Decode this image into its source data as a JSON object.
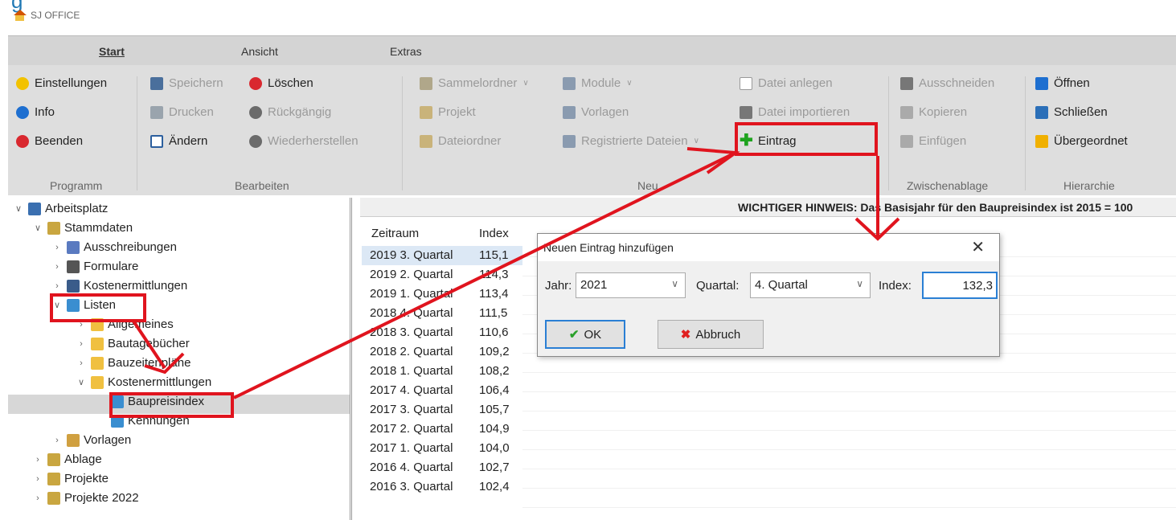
{
  "titlebar": {
    "app_name": "SJ OFFICE"
  },
  "tabs": [
    "Start",
    "Ansicht",
    "Extras"
  ],
  "ribbon": {
    "programm": {
      "label": "Programm",
      "items": [
        "Einstellungen",
        "Info",
        "Beenden"
      ]
    },
    "bearbeiten": {
      "label": "Bearbeiten",
      "items": [
        "Speichern",
        "Löschen",
        "Drucken",
        "Rückgängig",
        "Ändern",
        "Wiederherstellen"
      ]
    },
    "neu": {
      "label": "Neu",
      "items": [
        "Sammelordner",
        "Module",
        "Projekt",
        "Vorlagen",
        "Dateiordner",
        "Registrierte Dateien",
        "Datei anlegen",
        "Datei importieren",
        "Eintrag"
      ]
    },
    "zwischenablage": {
      "label": "Zwischenablage",
      "items": [
        "Ausschneiden",
        "Kopieren",
        "Einfügen"
      ]
    },
    "hierarchie": {
      "label": "Hierarchie",
      "items": [
        "Öffnen",
        "Schließen",
        "Übergeordnet"
      ]
    }
  },
  "tree": {
    "nodes": [
      "Arbeitsplatz",
      "Stammdaten",
      "Ausschreibungen",
      "Formulare",
      "Kostenermittlungen",
      "Listen",
      "Allgemeines",
      "Bautagebücher",
      "Bauzeitenpläne",
      "Kostenermittlungen",
      "Baupreisindex",
      "Kennungen",
      "Vorlagen",
      "Ablage",
      "Projekte",
      "Projekte 2022"
    ]
  },
  "notice": "WICHTIGER HINWEIS: Das Basisjahr für den Baupreisindex ist 2015 = 100",
  "table": {
    "headers": [
      "Zeitraum",
      "Index"
    ],
    "rows": [
      [
        "2019 3. Quartal",
        "115,1"
      ],
      [
        "2019 2. Quartal",
        "114,3"
      ],
      [
        "2019 1. Quartal",
        "113,4"
      ],
      [
        "2018 4. Quartal",
        "111,5"
      ],
      [
        "2018 3. Quartal",
        "110,6"
      ],
      [
        "2018 2. Quartal",
        "109,2"
      ],
      [
        "2018 1. Quartal",
        "108,2"
      ],
      [
        "2017 4. Quartal",
        "106,4"
      ],
      [
        "2017 3. Quartal",
        "105,7"
      ],
      [
        "2017 2. Quartal",
        "104,9"
      ],
      [
        "2017 1. Quartal",
        "104,0"
      ],
      [
        "2016 4. Quartal",
        "102,7"
      ],
      [
        "2016 3. Quartal",
        "102,4"
      ]
    ]
  },
  "dialog": {
    "title": "Neuen Eintrag hinzufügen",
    "jahr_label": "Jahr:",
    "jahr_value": "2021",
    "quartal_label": "Quartal:",
    "quartal_value": "4. Quartal",
    "index_label": "Index:",
    "index_value": "132,3",
    "ok_label": "OK",
    "cancel_label": "Abbruch"
  },
  "colors": {
    "highlight": "#e0141e",
    "focus": "#2a7fd4"
  }
}
